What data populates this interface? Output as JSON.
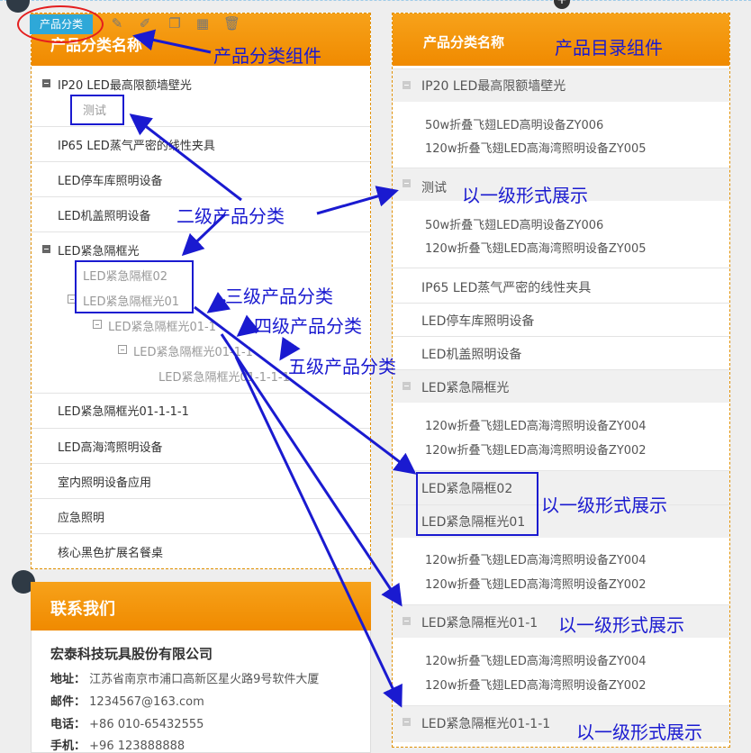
{
  "toolbar": {
    "tag_label": "产品分类",
    "icons": [
      "wrench-icon",
      "edit-icon",
      "copy-icon",
      "grid-icon",
      "trash-icon"
    ]
  },
  "left_panel": {
    "title": "产品分类名称",
    "items": [
      {
        "label": "IP20 LED最高限额墙壁光",
        "collapsible": true
      },
      {
        "label": "测试",
        "level": 2
      },
      {
        "label": "IP65 LED蒸气严密的线性夹具"
      },
      {
        "label": "LED停车库照明设备"
      },
      {
        "label": "LED机盖照明设备"
      },
      {
        "label": "LED紧急隔框光",
        "collapsible": true
      },
      {
        "label": "LED紧急隔框02",
        "level": 2
      },
      {
        "label": "LED紧急隔框光01",
        "level": 2
      },
      {
        "label": "LED紧急隔框光01-1",
        "level": 3
      },
      {
        "label": "LED紧急隔框光01-1-1",
        "level": 4
      },
      {
        "label": "LED紧急隔框光01-1-1-1",
        "level": 5
      },
      {
        "label": "LED紧急隔框光01-1-1-1"
      },
      {
        "label": "LED高海湾照明设备"
      },
      {
        "label": "室内照明设备应用"
      },
      {
        "label": "应急照明"
      },
      {
        "label": "核心黑色扩展名餐桌"
      }
    ]
  },
  "right_panel": {
    "title": "产品分类名称",
    "categories": [
      {
        "label": "IP20 LED最高限额墙壁光",
        "products": [
          "50w折叠飞翅LED高明设备ZY006",
          "120w折叠飞翅LED高海湾照明设备ZY005"
        ]
      },
      {
        "label": "测试",
        "products": [
          "50w折叠飞翅LED高明设备ZY006",
          "120w折叠飞翅LED高海湾照明设备ZY005"
        ]
      },
      {
        "label": "IP65 LED蒸气严密的线性夹具"
      },
      {
        "label": "LED停车库照明设备"
      },
      {
        "label": "LED机盖照明设备"
      },
      {
        "label": "LED紧急隔框光",
        "products": [
          "120w折叠飞翅LED高海湾照明设备ZY004",
          "120w折叠飞翅LED高海湾照明设备ZY002"
        ]
      },
      {
        "label": "LED紧急隔框02"
      },
      {
        "label": "LED紧急隔框光01",
        "products": [
          "120w折叠飞翅LED高海湾照明设备ZY004",
          "120w折叠飞翅LED高海湾照明设备ZY002"
        ]
      },
      {
        "label": "LED紧急隔框光01-1",
        "products": [
          "120w折叠飞翅LED高海湾照明设备ZY004",
          "120w折叠飞翅LED高海湾照明设备ZY002"
        ]
      },
      {
        "label": "LED紧急隔框光01-1-1"
      }
    ]
  },
  "contact": {
    "title": "联系我们",
    "company": "宏泰科技玩具股份有限公司",
    "address_label": "地址：",
    "address": "江苏省南京市浦口高新区星火路9号软件大厦",
    "email_label": "邮件：",
    "email": "1234567@163.com",
    "phone_label": "电话：",
    "phone": "+86 010-65432555",
    "mobile_label": "手机：",
    "mobile": "+96 123888888"
  },
  "annotations": {
    "component_category": "产品分类组件",
    "component_catalog": "产品目录组件",
    "level2": "二级产品分类",
    "level3": "三级产品分类",
    "level4": "四级产品分类",
    "level5": "五级产品分类",
    "show_flat_1": "以一级形式展示",
    "show_flat_2": "以一级形式展示",
    "show_flat_3": "以一级形式展示",
    "show_flat_4": "以一级形式展示"
  },
  "colors": {
    "header_orange": "#f39800",
    "annotation_blue": "#1a1ad0",
    "highlight_red": "#e41e1e",
    "tag_blue": "#2ea8d8"
  }
}
